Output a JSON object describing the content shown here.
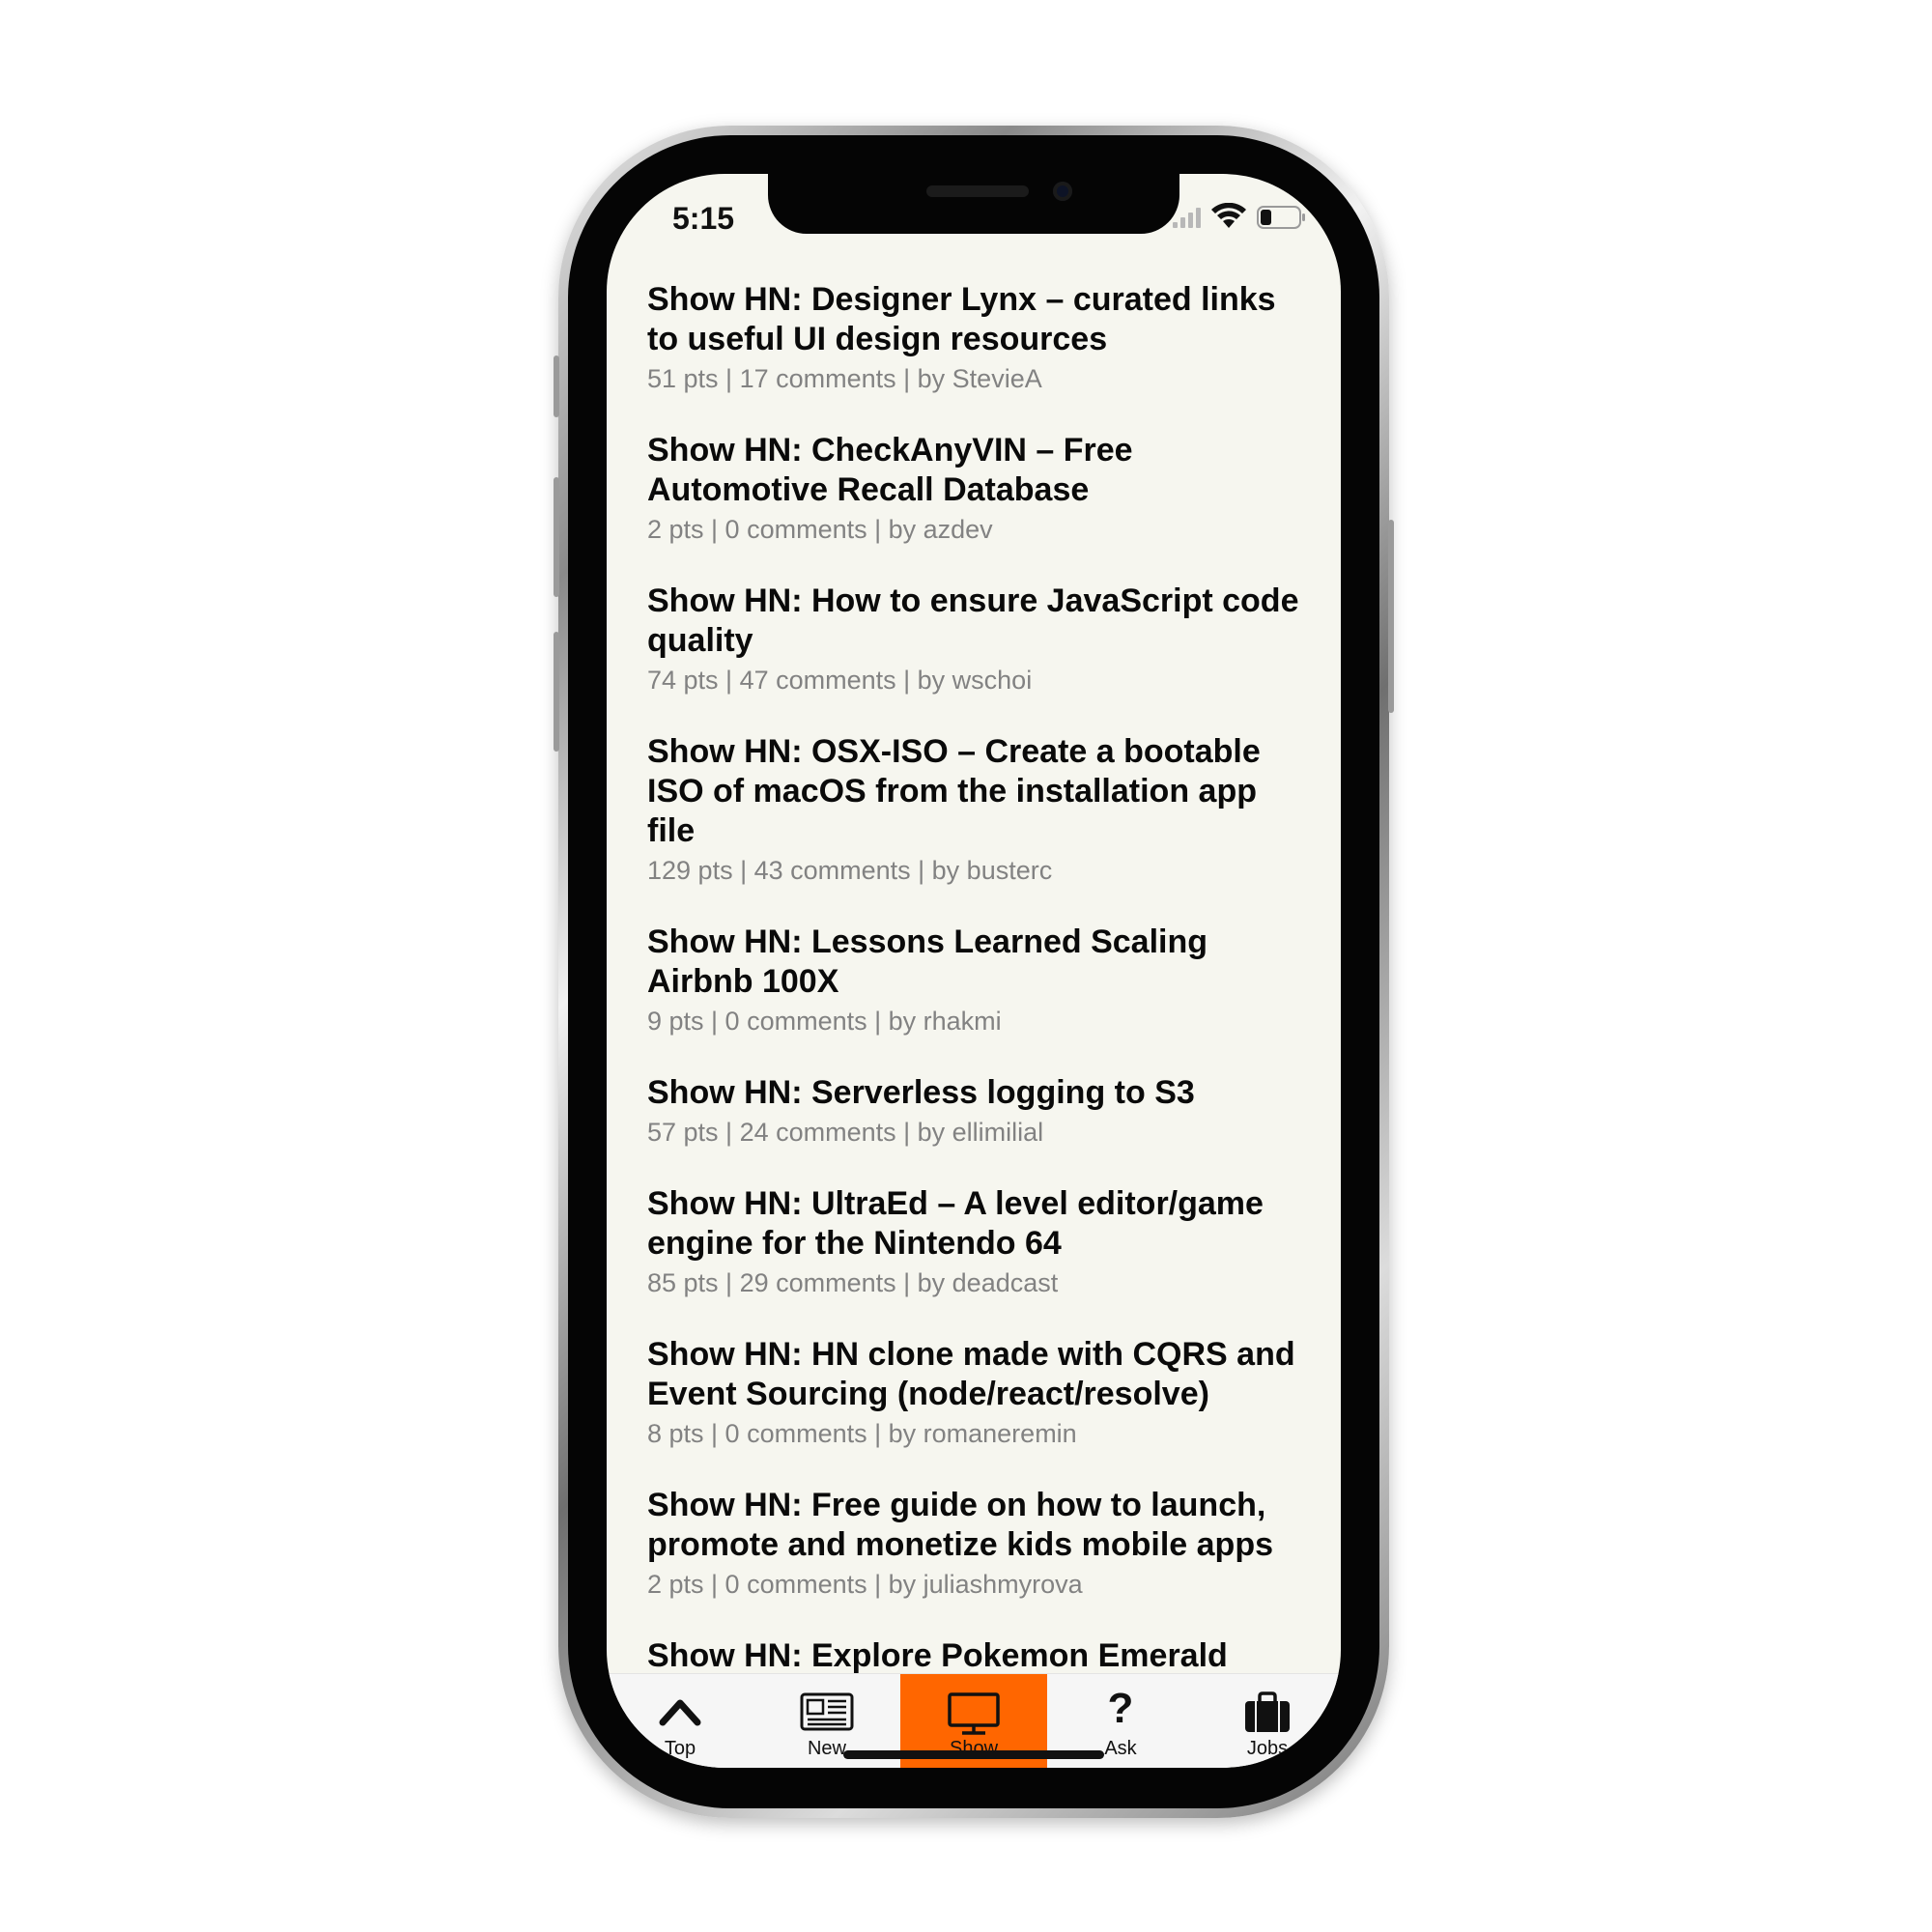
{
  "status_bar": {
    "time": "5:15"
  },
  "articles": [
    {
      "title": "Show HN: Designer Lynx – curated links to useful UI design resources",
      "meta": "51 pts | 17 comments | by StevieA"
    },
    {
      "title": "Show HN: CheckAnyVIN – Free Automotive Recall Database",
      "meta": "2 pts | 0 comments | by azdev"
    },
    {
      "title": "Show HN: How to ensure JavaScript code quality",
      "meta": "74 pts | 47 comments | by wschoi"
    },
    {
      "title": "Show HN: OSX-ISO – Create a bootable ISO of macOS from the installation app file",
      "meta": "129 pts | 43 comments | by busterc"
    },
    {
      "title": "Show HN: Lessons Learned Scaling Airbnb 100X",
      "meta": "9 pts | 0 comments | by rhakmi"
    },
    {
      "title": "Show HN: Serverless logging to S3",
      "meta": "57 pts | 24 comments | by ellimilial"
    },
    {
      "title": "Show HN: UltraEd – A level editor/game engine for the Nintendo 64",
      "meta": "85 pts | 29 comments | by deadcast"
    },
    {
      "title": "Show HN: HN clone made with CQRS and Event Sourcing (node/react/resolve)",
      "meta": "8 pts | 0 comments | by romaneremin"
    },
    {
      "title": "Show HN: Free guide on how to launch, promote and monetize kids mobile apps",
      "meta": "2 pts | 0 comments | by juliashmyrova"
    },
    {
      "title": "Show HN: Explore Pokemon Emerald",
      "meta": ""
    }
  ],
  "tab_bar": {
    "tabs": [
      {
        "label": "Top",
        "icon": "chevron-up-icon"
      },
      {
        "label": "New",
        "icon": "newspaper-icon"
      },
      {
        "label": "Show",
        "icon": "monitor-icon",
        "active": true
      },
      {
        "label": "Ask",
        "icon": "question-mark-icon"
      },
      {
        "label": "Jobs",
        "icon": "briefcase-icon"
      }
    ],
    "ask_glyph": "?"
  },
  "colors": {
    "accent": "#ff6600",
    "background": "#f6f6ef",
    "meta_text": "#828282"
  }
}
